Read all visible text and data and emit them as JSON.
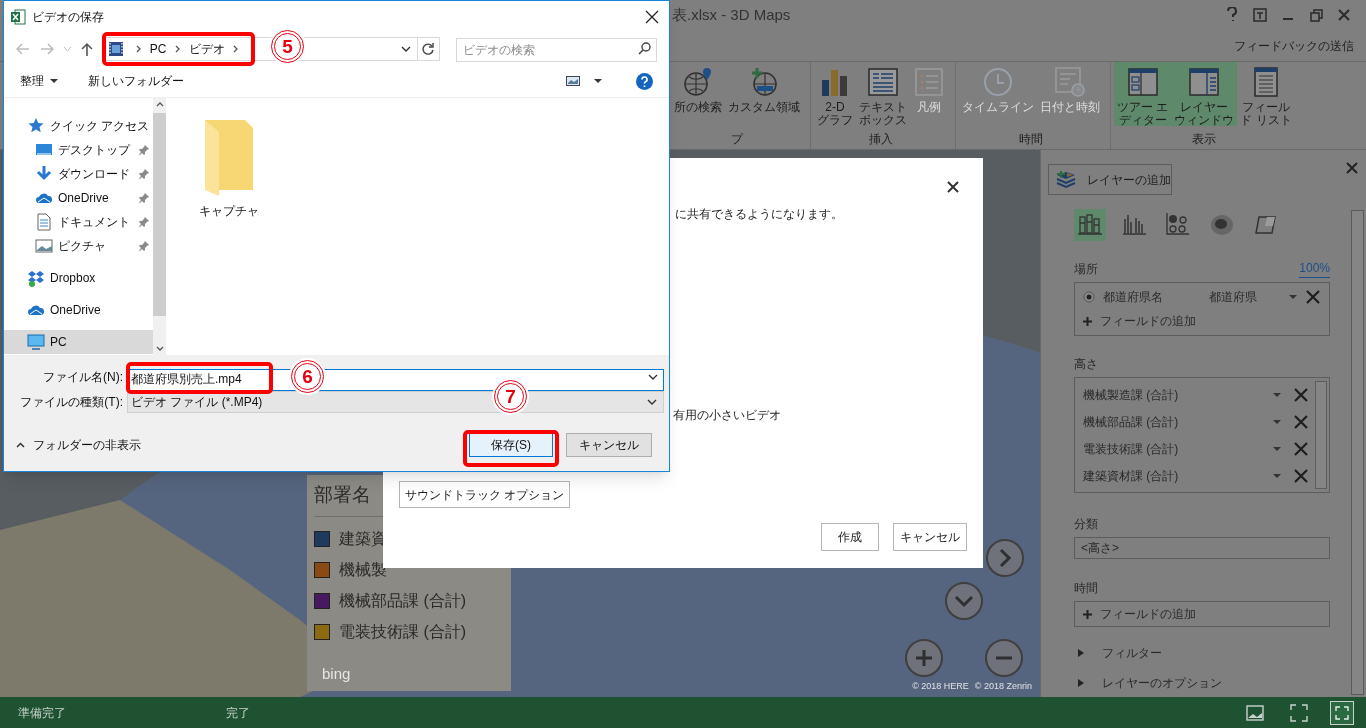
{
  "app": {
    "title": "表.xlsx - 3D Maps",
    "feedback": "フィードバックの送信",
    "ribbon_groups": [
      {
        "label": "プ",
        "buttons": [
          {
            "lines": [
              "所の検索"
            ],
            "kind": "globe-pin",
            "disabled": false,
            "selected": false
          },
          {
            "lines": [
              "カスタム領域"
            ],
            "kind": "globe-plus",
            "disabled": false,
            "selected": false
          }
        ]
      },
      {
        "label": "挿入",
        "buttons": [
          {
            "lines": [
              "2-D",
              "グラフ"
            ],
            "kind": "bar-chart",
            "disabled": false,
            "selected": false
          },
          {
            "lines": [
              "テキスト",
              "ボックス"
            ],
            "kind": "text-box",
            "disabled": false,
            "selected": false
          },
          {
            "lines": [
              "凡例"
            ],
            "kind": "legend",
            "disabled": true,
            "selected": false
          }
        ]
      },
      {
        "label": "時間",
        "buttons": [
          {
            "lines": [
              "タイムライン"
            ],
            "kind": "clock",
            "disabled": true,
            "selected": false
          },
          {
            "lines": [
              "日付と時刻"
            ],
            "kind": "date-time",
            "disabled": true,
            "selected": false
          }
        ]
      },
      {
        "label": "表示",
        "buttons": [
          {
            "lines": [
              "ツアー エ",
              "ディター"
            ],
            "kind": "tour-pane",
            "disabled": false,
            "selected": true
          },
          {
            "lines": [
              "レイヤー",
              "ウィンドウ"
            ],
            "kind": "layer-pane",
            "disabled": false,
            "selected": true
          },
          {
            "lines": [
              "フィール",
              "ド リスト"
            ],
            "kind": "field-list",
            "disabled": false,
            "selected": false
          }
        ]
      }
    ],
    "legend": {
      "title": "部署名",
      "items": [
        {
          "label": "建築資",
          "color": "#1f3a5c"
        },
        {
          "label": "機械製",
          "color": "#8a4a14"
        },
        {
          "label": "機械部品課 (合計)",
          "color": "#47195e"
        },
        {
          "label": "電装技術課 (合計)",
          "color": "#8c6a12"
        }
      ]
    },
    "map_logo": "bing",
    "copyrights": [
      "© 2018 HERE",
      "© 2018 Zenrin"
    ],
    "layer_panel": {
      "add_layer": "レイヤーの追加",
      "viz_types": [
        {
          "kind": "stacked-column",
          "selected": true
        },
        {
          "kind": "clustered-column",
          "selected": false
        },
        {
          "kind": "bubble",
          "selected": false
        },
        {
          "kind": "heat-map",
          "selected": false
        },
        {
          "kind": "region",
          "selected": false
        }
      ],
      "location": {
        "label": "場所",
        "percent": "100%",
        "fields": [
          {
            "name": "都道府県名",
            "type": "都道府県",
            "selected": true
          }
        ],
        "add_field": "フィールドの追加"
      },
      "height": {
        "label": "高さ",
        "fields": [
          "機械製造課 (合計)",
          "機械部品課 (合計)",
          "電装技術課 (合計)",
          "建築資材課 (合計)"
        ]
      },
      "category": {
        "label": "分類",
        "value": "<高さ>"
      },
      "time": {
        "label": "時間",
        "add_field": "フィールドの追加"
      },
      "sections": [
        {
          "label": "フィルター",
          "expanded": false
        },
        {
          "label": "レイヤーのオプション",
          "expanded": false
        }
      ]
    },
    "status_bar": {
      "left": "準備完了",
      "middle": "完了"
    }
  },
  "video_dialog": {
    "line_1": "に共有できるようになります。",
    "line_2": "有用の小さいビデオ",
    "soundtrack_button": "サウンドトラック オプション",
    "create_button": "作成",
    "cancel_button": "キャンセル"
  },
  "save_dialog": {
    "title": "ビデオの保存",
    "breadcrumbs": [
      "PC",
      "ビデオ"
    ],
    "search": {
      "placeholder": "ビデオの検索"
    },
    "toolbar": {
      "organize": "整理",
      "new_folder": "新しいフォルダー"
    },
    "nav": [
      {
        "label": "クイック アクセス",
        "kind": "star",
        "pinned": false,
        "selected": false,
        "children": [
          {
            "label": "デスクトップ",
            "kind": "desktop",
            "pinned": true,
            "selected": false
          },
          {
            "label": "ダウンロード",
            "kind": "download",
            "pinned": true,
            "selected": false
          },
          {
            "label": "OneDrive",
            "kind": "cloud",
            "pinned": true,
            "selected": false
          },
          {
            "label": "ドキュメント",
            "kind": "document",
            "pinned": true,
            "selected": false
          },
          {
            "label": "ピクチャ",
            "kind": "picture",
            "pinned": true,
            "selected": false
          }
        ]
      },
      {
        "label": "Dropbox",
        "kind": "dropbox",
        "pinned": false,
        "selected": false
      },
      {
        "label": "OneDrive",
        "kind": "cloud",
        "pinned": false,
        "selected": false
      },
      {
        "label": "PC",
        "kind": "pc",
        "pinned": false,
        "selected": true
      }
    ],
    "folders": [
      "キャプチャ"
    ],
    "file_name": {
      "label": "ファイル名(N):",
      "value": "都道府県別売上.mp4"
    },
    "file_type": {
      "label": "ファイルの種類(T):",
      "value": "ビデオ ファイル (*.MP4)"
    },
    "hide_folders": "フォルダーの非表示",
    "save_button": "保存(S)",
    "cancel_button": "キャンセル"
  },
  "callouts": [
    "5",
    "6",
    "7"
  ]
}
